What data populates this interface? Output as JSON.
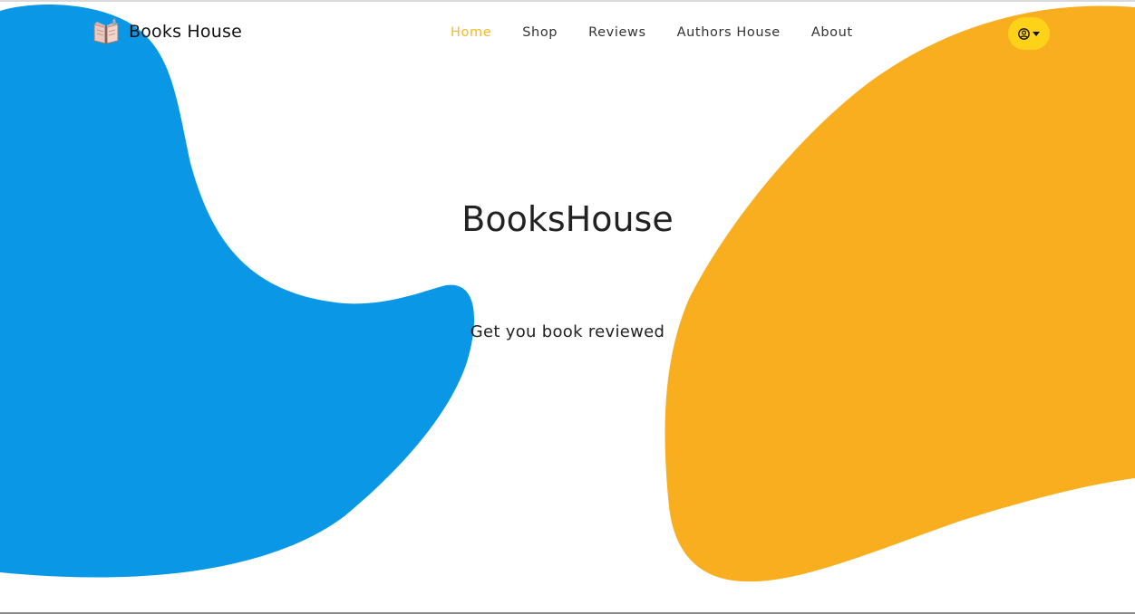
{
  "brand": {
    "name": "Books House",
    "logo_icon": "open-book-icon"
  },
  "nav": {
    "items": [
      {
        "label": "Home",
        "active": true
      },
      {
        "label": "Shop",
        "active": false
      },
      {
        "label": "Reviews",
        "active": false
      },
      {
        "label": "Authors House",
        "active": false
      },
      {
        "label": "About",
        "active": false
      }
    ]
  },
  "user_menu": {
    "icon": "user-circle-icon",
    "caret_icon": "caret-down-icon"
  },
  "hero": {
    "title": "BooksHouse",
    "subtitle": "Get you book reviewed"
  },
  "colors": {
    "blue_blob": "#0a98e6",
    "orange_blob": "#f9ae1f",
    "active_nav": "#f7b924",
    "user_button": "#ffd21a"
  }
}
